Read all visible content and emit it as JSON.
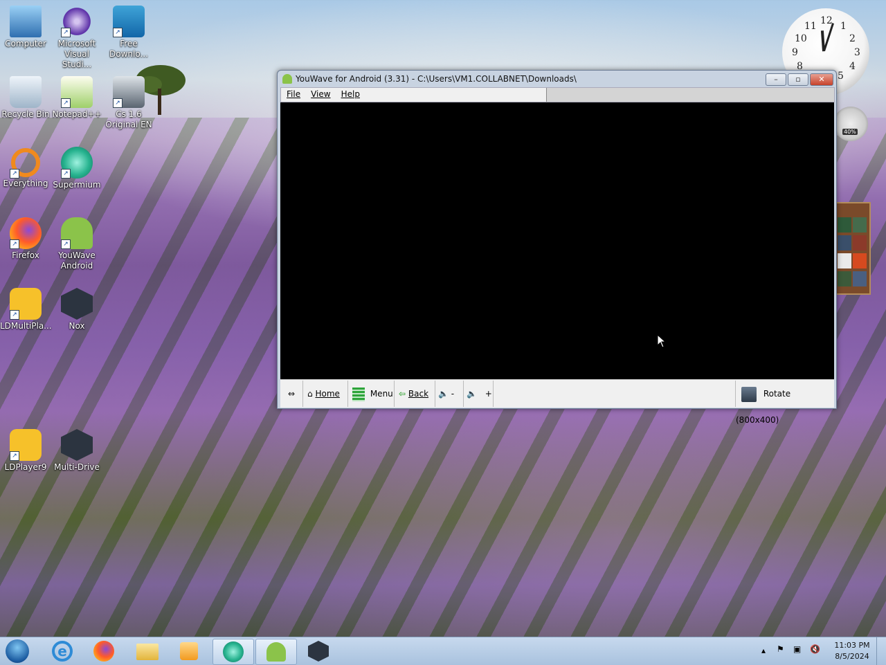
{
  "desktop": {
    "icons": [
      {
        "label_line1": "Computer",
        "label_line2": "",
        "icon": "computer-icon"
      },
      {
        "label_line1": "Microsoft",
        "label_line2": "Visual Studi...",
        "icon": "visual-studio-icon"
      },
      {
        "label_line1": "Free",
        "label_line2": "Downlo...",
        "icon": "free-download-manager-icon"
      },
      {
        "label_line1": "Recycle Bin",
        "label_line2": "",
        "icon": "recycle-bin-icon"
      },
      {
        "label_line1": "Notepad++",
        "label_line2": "",
        "icon": "notepadpp-icon"
      },
      {
        "label_line1": "Cs 1.6",
        "label_line2": "Original EN",
        "icon": "counter-strike-icon"
      },
      {
        "label_line1": "Everything",
        "label_line2": "",
        "icon": "everything-search-icon"
      },
      {
        "label_line1": "Supermium",
        "label_line2": "",
        "icon": "supermium-icon"
      },
      {
        "label_line1": "Firefox",
        "label_line2": "",
        "icon": "firefox-icon"
      },
      {
        "label_line1": "YouWave",
        "label_line2": "Android",
        "icon": "youwave-android-icon"
      },
      {
        "label_line1": "LDMultiPla...",
        "label_line2": "",
        "icon": "ldmultiplayer-icon"
      },
      {
        "label_line1": "Nox",
        "label_line2": "",
        "icon": "nox-icon"
      },
      {
        "label_line1": "LDPlayer9",
        "label_line2": "",
        "icon": "ldplayer9-icon"
      },
      {
        "label_line1": "Multi-Drive",
        "label_line2": "",
        "icon": "nox-multi-drive-icon"
      }
    ]
  },
  "window": {
    "title": "YouWave for Android (3.31) - C:\\Users\\VM1.COLLABNET\\Downloads\\",
    "menu": [
      "File",
      "View",
      "Help"
    ],
    "toolbar": {
      "home": "Home",
      "menu": "Menu",
      "back": "Back",
      "vol_down": "-",
      "vol_up": "+",
      "rotate": "Rotate (800x400)"
    }
  },
  "gadgets": {
    "clock_numbers": [
      "12",
      "1",
      "2",
      "3",
      "4",
      "5",
      "8",
      "9",
      "10",
      "11"
    ],
    "cpu_percent": "40%"
  },
  "taskbar": {
    "time": "11:03 PM",
    "date": "8/5/2024",
    "items": [
      "start-orb",
      "internet-explorer",
      "firefox",
      "file-explorer",
      "media-player",
      "supermium",
      "youwave-android",
      "nox"
    ]
  }
}
